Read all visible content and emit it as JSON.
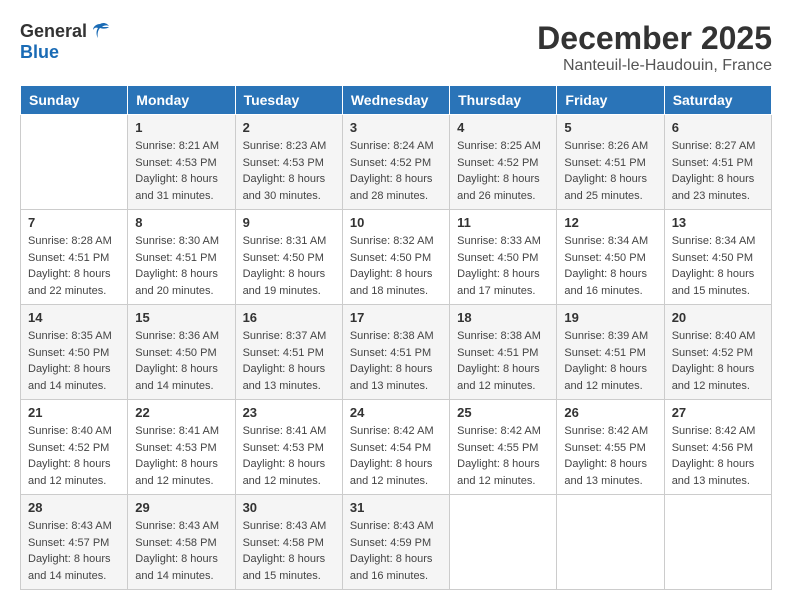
{
  "logo": {
    "general": "General",
    "blue": "Blue"
  },
  "title": "December 2025",
  "location": "Nanteuil-le-Haudouin, France",
  "headers": [
    "Sunday",
    "Monday",
    "Tuesday",
    "Wednesday",
    "Thursday",
    "Friday",
    "Saturday"
  ],
  "weeks": [
    [
      {
        "day": "",
        "info": ""
      },
      {
        "day": "1",
        "info": "Sunrise: 8:21 AM\nSunset: 4:53 PM\nDaylight: 8 hours\nand 31 minutes."
      },
      {
        "day": "2",
        "info": "Sunrise: 8:23 AM\nSunset: 4:53 PM\nDaylight: 8 hours\nand 30 minutes."
      },
      {
        "day": "3",
        "info": "Sunrise: 8:24 AM\nSunset: 4:52 PM\nDaylight: 8 hours\nand 28 minutes."
      },
      {
        "day": "4",
        "info": "Sunrise: 8:25 AM\nSunset: 4:52 PM\nDaylight: 8 hours\nand 26 minutes."
      },
      {
        "day": "5",
        "info": "Sunrise: 8:26 AM\nSunset: 4:51 PM\nDaylight: 8 hours\nand 25 minutes."
      },
      {
        "day": "6",
        "info": "Sunrise: 8:27 AM\nSunset: 4:51 PM\nDaylight: 8 hours\nand 23 minutes."
      }
    ],
    [
      {
        "day": "7",
        "info": "Sunrise: 8:28 AM\nSunset: 4:51 PM\nDaylight: 8 hours\nand 22 minutes."
      },
      {
        "day": "8",
        "info": "Sunrise: 8:30 AM\nSunset: 4:51 PM\nDaylight: 8 hours\nand 20 minutes."
      },
      {
        "day": "9",
        "info": "Sunrise: 8:31 AM\nSunset: 4:50 PM\nDaylight: 8 hours\nand 19 minutes."
      },
      {
        "day": "10",
        "info": "Sunrise: 8:32 AM\nSunset: 4:50 PM\nDaylight: 8 hours\nand 18 minutes."
      },
      {
        "day": "11",
        "info": "Sunrise: 8:33 AM\nSunset: 4:50 PM\nDaylight: 8 hours\nand 17 minutes."
      },
      {
        "day": "12",
        "info": "Sunrise: 8:34 AM\nSunset: 4:50 PM\nDaylight: 8 hours\nand 16 minutes."
      },
      {
        "day": "13",
        "info": "Sunrise: 8:34 AM\nSunset: 4:50 PM\nDaylight: 8 hours\nand 15 minutes."
      }
    ],
    [
      {
        "day": "14",
        "info": "Sunrise: 8:35 AM\nSunset: 4:50 PM\nDaylight: 8 hours\nand 14 minutes."
      },
      {
        "day": "15",
        "info": "Sunrise: 8:36 AM\nSunset: 4:50 PM\nDaylight: 8 hours\nand 14 minutes."
      },
      {
        "day": "16",
        "info": "Sunrise: 8:37 AM\nSunset: 4:51 PM\nDaylight: 8 hours\nand 13 minutes."
      },
      {
        "day": "17",
        "info": "Sunrise: 8:38 AM\nSunset: 4:51 PM\nDaylight: 8 hours\nand 13 minutes."
      },
      {
        "day": "18",
        "info": "Sunrise: 8:38 AM\nSunset: 4:51 PM\nDaylight: 8 hours\nand 12 minutes."
      },
      {
        "day": "19",
        "info": "Sunrise: 8:39 AM\nSunset: 4:51 PM\nDaylight: 8 hours\nand 12 minutes."
      },
      {
        "day": "20",
        "info": "Sunrise: 8:40 AM\nSunset: 4:52 PM\nDaylight: 8 hours\nand 12 minutes."
      }
    ],
    [
      {
        "day": "21",
        "info": "Sunrise: 8:40 AM\nSunset: 4:52 PM\nDaylight: 8 hours\nand 12 minutes."
      },
      {
        "day": "22",
        "info": "Sunrise: 8:41 AM\nSunset: 4:53 PM\nDaylight: 8 hours\nand 12 minutes."
      },
      {
        "day": "23",
        "info": "Sunrise: 8:41 AM\nSunset: 4:53 PM\nDaylight: 8 hours\nand 12 minutes."
      },
      {
        "day": "24",
        "info": "Sunrise: 8:42 AM\nSunset: 4:54 PM\nDaylight: 8 hours\nand 12 minutes."
      },
      {
        "day": "25",
        "info": "Sunrise: 8:42 AM\nSunset: 4:55 PM\nDaylight: 8 hours\nand 12 minutes."
      },
      {
        "day": "26",
        "info": "Sunrise: 8:42 AM\nSunset: 4:55 PM\nDaylight: 8 hours\nand 13 minutes."
      },
      {
        "day": "27",
        "info": "Sunrise: 8:42 AM\nSunset: 4:56 PM\nDaylight: 8 hours\nand 13 minutes."
      }
    ],
    [
      {
        "day": "28",
        "info": "Sunrise: 8:43 AM\nSunset: 4:57 PM\nDaylight: 8 hours\nand 14 minutes."
      },
      {
        "day": "29",
        "info": "Sunrise: 8:43 AM\nSunset: 4:58 PM\nDaylight: 8 hours\nand 14 minutes."
      },
      {
        "day": "30",
        "info": "Sunrise: 8:43 AM\nSunset: 4:58 PM\nDaylight: 8 hours\nand 15 minutes."
      },
      {
        "day": "31",
        "info": "Sunrise: 8:43 AM\nSunset: 4:59 PM\nDaylight: 8 hours\nand 16 minutes."
      },
      {
        "day": "",
        "info": ""
      },
      {
        "day": "",
        "info": ""
      },
      {
        "day": "",
        "info": ""
      }
    ]
  ]
}
